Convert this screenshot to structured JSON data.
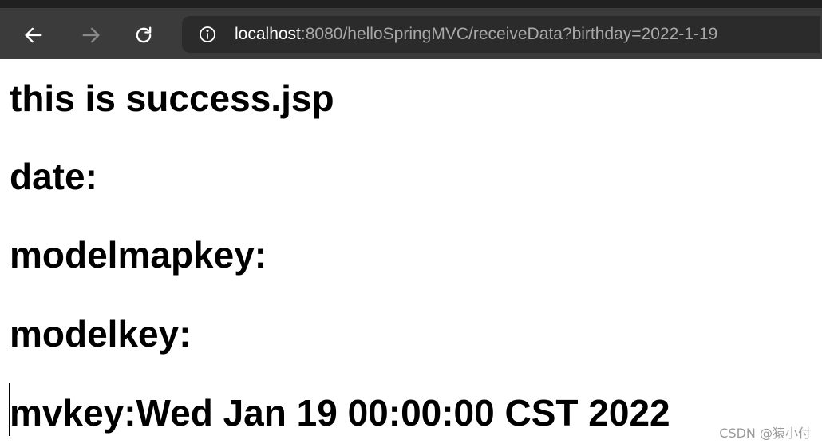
{
  "browser": {
    "url_host": "localhost",
    "url_rest": ":8080/helloSpringMVC/receiveData?birthday=2022-1-19",
    "back_icon": "back-arrow-icon",
    "forward_icon": "forward-arrow-icon",
    "reload_icon": "reload-icon",
    "info_icon": "info-icon"
  },
  "page": {
    "heading": "this is success.jsp",
    "date_line": "date:",
    "modelmapkey_line": "modelmapkey:",
    "modelkey_line": "modelkey:",
    "mvkey_line": "mvkey:Wed Jan 19 00:00:00 CST 2022"
  },
  "watermark": "CSDN @猿小付",
  "colors": {
    "toolbar": "#3b3b3b",
    "address_bar": "#2b2b2b",
    "page_background": "#ffffff",
    "text": "#000000"
  }
}
